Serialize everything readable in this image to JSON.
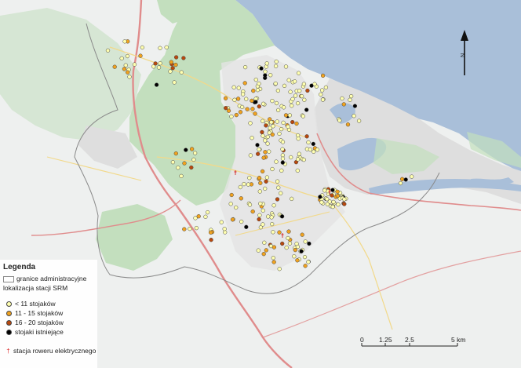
{
  "map": {
    "colors": {
      "sea": "#a9bfd9",
      "land": "#eef0ef",
      "forest": "#c3dfbe",
      "urban": "#dedede",
      "major_road": "#e08c8c",
      "road": "#f2d98a",
      "boundary": "#8a8a8a",
      "rail": "#999999"
    },
    "stations": [
      {
        "cls": "lt11",
        "color": "#ffffb0"
      },
      {
        "cls": "r11_15",
        "color": "#f0a21f"
      },
      {
        "cls": "r16_20",
        "color": "#b8480e"
      },
      {
        "cls": "existing",
        "color": "#000000"
      },
      {
        "cls": "electric",
        "color": "#d22222"
      }
    ]
  },
  "legend": {
    "title": "Legenda",
    "boundary": "granice administracyjne",
    "section": "lokalizacja stacji SRM",
    "items": [
      {
        "label": "< 11 stojaków",
        "color": "#ffffb0"
      },
      {
        "label": "11 - 15 stojaków",
        "color": "#f0a21f"
      },
      {
        "label": "16 - 20 stojaków",
        "color": "#b8480e"
      },
      {
        "label": "stojaki istniejące",
        "color": "#000000"
      }
    ],
    "electric": "stacja roweru elektrycznego"
  },
  "scale": {
    "ticks": [
      "0",
      "1.25",
      "2.5",
      "5 km"
    ]
  },
  "north": {
    "label": "N",
    "icon": "north-arrow-icon"
  }
}
